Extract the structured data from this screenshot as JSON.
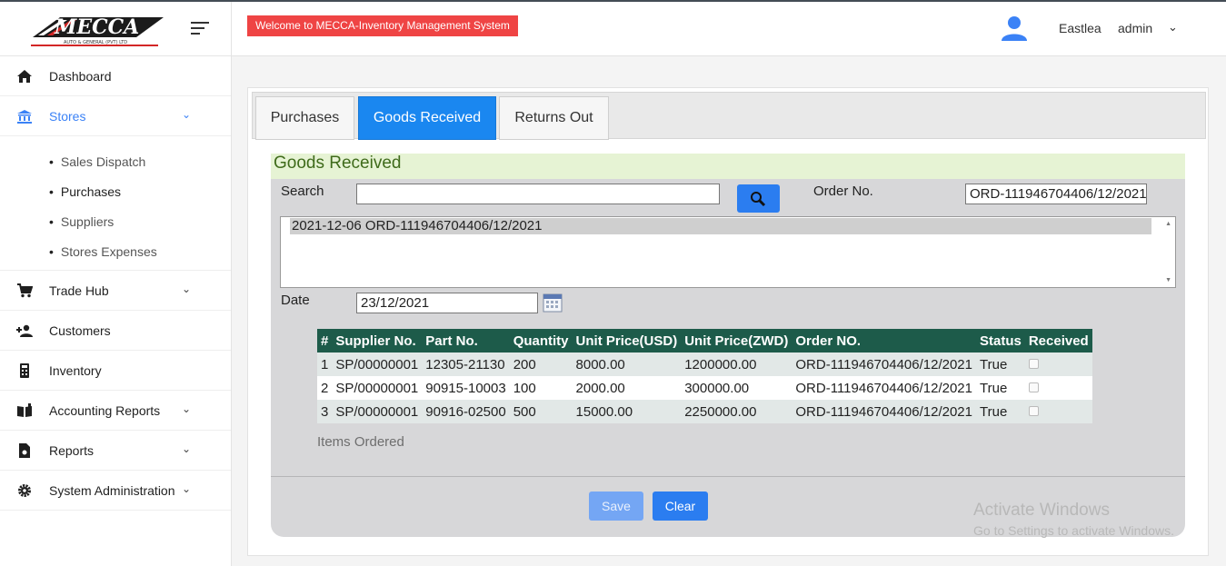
{
  "brand": {
    "name": "MECCA",
    "tagline": "AUTO & GENERAL (PVT) LTD"
  },
  "header": {
    "welcome": "Welcome to MECCA-Inventory Management System",
    "site": "Eastlea",
    "user": "admin"
  },
  "sidebar": {
    "items": [
      {
        "label": "Dashboard",
        "icon": "home-icon"
      },
      {
        "label": "Stores",
        "icon": "bank-icon",
        "expanded": true
      },
      {
        "label": "Trade Hub",
        "icon": "cart-icon"
      },
      {
        "label": "Customers",
        "icon": "person-add-icon"
      },
      {
        "label": "Inventory",
        "icon": "calculator-icon"
      },
      {
        "label": "Accounting Reports",
        "icon": "book-icon"
      },
      {
        "label": "Reports",
        "icon": "file-icon"
      },
      {
        "label": "System Administration",
        "icon": "gear-icon"
      }
    ],
    "stores_sub": [
      "Sales Dispatch",
      "Purchases",
      "Suppliers",
      "Stores Expenses"
    ]
  },
  "tabs": [
    "Purchases",
    "Goods Received",
    "Returns Out"
  ],
  "form": {
    "title": "Goods Received",
    "search_label": "Search",
    "search_value": "",
    "order_label": "Order No.",
    "order_value": "ORD-111946704406/12/2021",
    "list_option": "2021-12-06 ORD-111946704406/12/2021",
    "date_label": "Date",
    "date_value": "23/12/2021",
    "items_label": "Items Ordered",
    "save_label": "Save",
    "clear_label": "Clear"
  },
  "table": {
    "headers": [
      "#",
      "Supplier No.",
      "Part No.",
      "Quantity",
      "Unit Price(USD)",
      "Unit Price(ZWD)",
      "Order NO.",
      "Status",
      "Received"
    ],
    "rows": [
      [
        "1",
        "SP/00000001",
        "12305-21130",
        "200",
        "8000.00",
        "1200000.00",
        "ORD-111946704406/12/2021",
        "True"
      ],
      [
        "2",
        "SP/00000001",
        "90915-10003",
        "100",
        "2000.00",
        "300000.00",
        "ORD-111946704406/12/2021",
        "True"
      ],
      [
        "3",
        "SP/00000001",
        "90916-02500",
        "500",
        "15000.00",
        "2250000.00",
        "ORD-111946704406/12/2021",
        "True"
      ]
    ]
  },
  "watermark": {
    "line1": "Activate Windows",
    "line2": "Go to Settings to activate Windows."
  },
  "colors": {
    "accent": "#1a87f0",
    "header_row": "#1d5b4a",
    "welcome": "#ef4444",
    "title_bg": "#e6f3d4"
  }
}
